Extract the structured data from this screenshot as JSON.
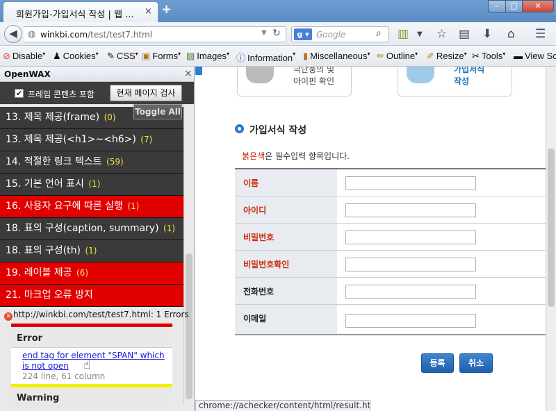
{
  "browser": {
    "tab_title": "회원가입-가입서식 작성 | 웹 ...",
    "tab_close": "×",
    "new_tab": "+",
    "url_host": "winkbi.com",
    "url_path": "/test/test7.html",
    "search_placeholder": "Google",
    "window_buttons": {
      "minimize": "–",
      "maximize": "□",
      "close": "✕"
    }
  },
  "webdev_toolbar": {
    "items": [
      {
        "label": "Disable",
        "icon": "disable-icon"
      },
      {
        "label": "Cookies",
        "icon": "cookie-icon"
      },
      {
        "label": "CSS",
        "icon": "css-icon"
      },
      {
        "label": "Forms",
        "icon": "forms-icon"
      },
      {
        "label": "Images",
        "icon": "images-icon"
      },
      {
        "label": "Information",
        "icon": "info-icon"
      },
      {
        "label": "Miscellaneous",
        "icon": "misc-icon"
      },
      {
        "label": "Outline",
        "icon": "outline-icon"
      },
      {
        "label": "Resize",
        "icon": "resize-icon"
      },
      {
        "label": "Tools",
        "icon": "tools-icon"
      },
      {
        "label": "View Sc",
        "icon": "view-source-icon"
      }
    ]
  },
  "sidebar": {
    "title": "OpenWAX",
    "close": "×",
    "frame_checkbox_label": "프레임 콘텐츠 포함",
    "frame_checked": true,
    "check_button": "현재 페이지 검사",
    "toggle_all": "Toggle All",
    "rows": [
      {
        "label": "13. 제목 제공(frame)",
        "count": "(0)",
        "status": "pass"
      },
      {
        "label": "13. 제목 제공(<h1>~<h6>)",
        "count": "(7)",
        "status": "pass"
      },
      {
        "label": "14. 적절한 링크 텍스트",
        "count": "(59)",
        "status": "pass"
      },
      {
        "label": "15. 기본 언어 표시",
        "count": "(1)",
        "status": "pass"
      },
      {
        "label": "16. 사용자 요구에 따른 실행",
        "count": "(1)",
        "status": "fail"
      },
      {
        "label": "18. 표의 구성(caption, summary)",
        "count": "(1)",
        "status": "pass"
      },
      {
        "label": "18. 표의 구성(th)",
        "count": "(1)",
        "status": "pass"
      },
      {
        "label": "19. 레이블 제공",
        "count": "(6)",
        "status": "fail"
      },
      {
        "label": "21. 마크업 오류 방지",
        "count": "",
        "status": "fail"
      }
    ],
    "result_url": "http://winkbi.com/test/test7.html: 1 Errors",
    "error_heading": "Error",
    "error_link": "end tag for element \"SPAN\" which is not open",
    "error_location": "224 line, 61 column",
    "warning_heading": "Warning"
  },
  "page": {
    "card1_text_line1": "극단풍의 및",
    "card1_text_line2": "아이핀 확인",
    "card2_text_line1": "가입서식",
    "card2_text_line2": "작성",
    "section_title": "가입서식 작성",
    "required_note_red": "붉은색",
    "required_note_rest": "은 필수입력 항목입니다.",
    "form_rows": [
      {
        "label": "이름",
        "required": true,
        "value": ""
      },
      {
        "label": "아이디",
        "required": true,
        "value": ""
      },
      {
        "label": "비밀번호",
        "required": true,
        "value": ""
      },
      {
        "label": "비밀번호확인",
        "required": true,
        "value": ""
      },
      {
        "label": "전화번호",
        "required": false,
        "value": ""
      },
      {
        "label": "이메일",
        "required": false,
        "value": ""
      }
    ],
    "submit_button": "등록",
    "cancel_button": "취소"
  },
  "status_bar": "chrome://achecker/content/html/result.html#",
  "colors": {
    "fail_row": "#e00000",
    "pass_row": "#3a3a3a",
    "required_label": "#d0280a",
    "accent": "#2b7ac7"
  }
}
